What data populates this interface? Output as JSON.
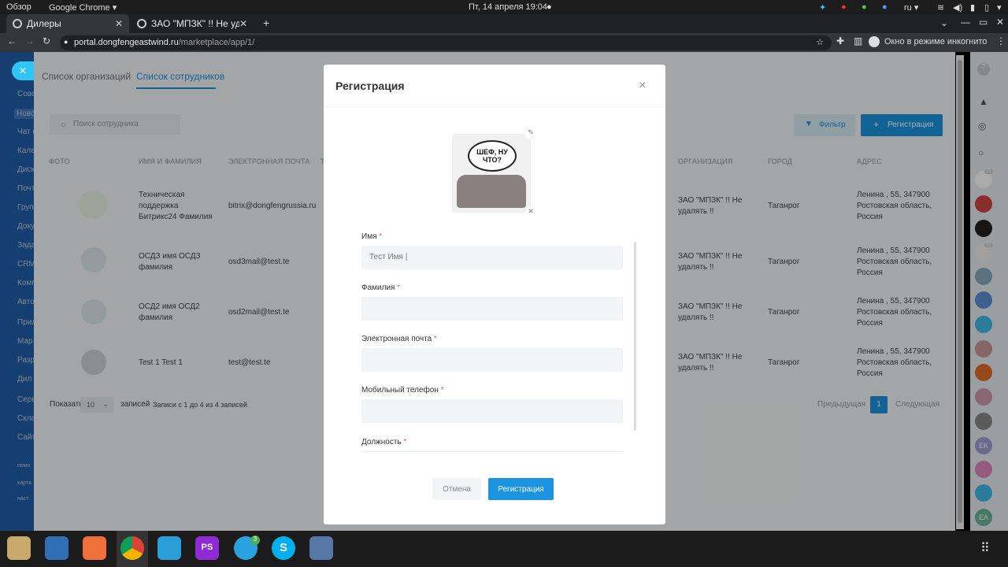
{
  "os": {
    "activities": "Обзор",
    "app_menu": "Google Chrome ▾",
    "clock": "Пт, 14 апреля  19:04",
    "lang": "ru ▾"
  },
  "browser": {
    "tabs": [
      {
        "title": "Дилеры",
        "active": true
      },
      {
        "title": "ЗАО \"МПЗК\" !! Не удалять"
      }
    ],
    "new_tab": "+",
    "url_host": "portal.dongfengeastwind.ru",
    "url_path": "/marketplace/app/1/",
    "incognito": "Окно в режиме инкогнито"
  },
  "leftnav": {
    "items": [
      "Совс",
      "Новс",
      "Чат и",
      "Кале",
      "Диск",
      "Почт",
      "Груп",
      "Доку",
      "Зада",
      "CRM",
      "Комп",
      "Авто",
      "Прил",
      "Мар",
      "Разр",
      "Дил",
      "Серв",
      "Скла",
      "Сайт",
      "помо",
      "карта",
      "наст"
    ]
  },
  "page": {
    "tabs": [
      "Список организаций",
      "Список сотрудников"
    ],
    "search_placeholder": "Поиск сотрудника",
    "filter_button": "Фильтр",
    "register_button": "Регистрация",
    "columns": [
      "ФОТО",
      "ИМЯ И ФАМИЛИЯ",
      "ЭЛЕКТРОННАЯ ПОЧТА",
      "Т",
      "ОРГАНИЗАЦИЯ",
      "ГОРОД",
      "АДРЕС"
    ],
    "rows": [
      {
        "name": "Техническая поддержка Битрикс24 Фамилия",
        "email": "bitrix@dongfengrussia.ru",
        "org": "ЗАО \"МПЗК\" !! Не удалять !!",
        "city": "Таганрог",
        "address": "Ленина , 55, 347900 Ростовская область, Россия"
      },
      {
        "name": "ОСДЗ имя ОСДЗ фамилия",
        "email": "osd3mail@test.te",
        "org": "ЗАО \"МПЗК\" !! Не удалять !!",
        "city": "Таганрог",
        "address": "Ленина , 55, 347900 Ростовская область, Россия"
      },
      {
        "name": "ОСД2 имя ОСД2 фамилия",
        "email": "osd2mail@test.te",
        "org": "ЗАО \"МПЗК\" !! Не удалять !!",
        "city": "Таганрог",
        "address": "Ленина , 55, 347900 Ростовская область, Россия"
      },
      {
        "name": "Test 1 Test 1",
        "email": "test@test.te",
        "org": "ЗАО \"МПЗК\" !! Не удалять !!",
        "city": "Таганрог",
        "address": "Ленина , 55, 347900 Ростовская область, Россия"
      }
    ],
    "show_label": "Показать",
    "page_size": "10",
    "records_label": "записей",
    "records_info": "Записи с 1 до 4 из 4 записей",
    "prev": "Предыдущая",
    "current_page": "1",
    "next": "Следующая"
  },
  "modal": {
    "title": "Регистрация",
    "close": "×",
    "avatar_text": "ШЕФ, НУ ЧТО?",
    "fields": [
      {
        "label": "Имя",
        "value": "Тест Имя |"
      },
      {
        "label": "Фамилия",
        "value": ""
      },
      {
        "label": "Электронная почта",
        "value": ""
      },
      {
        "label": "Мобильный телефон",
        "value": ""
      },
      {
        "label": "Должность",
        "value": ""
      }
    ],
    "required_mark": "*",
    "cancel": "Отмена",
    "submit": "Регистрация"
  },
  "rightbar": {
    "badges": [
      "26",
      "5",
      "60"
    ],
    "initials": [
      "EK",
      "EA"
    ]
  },
  "dock": {
    "telegram_badge": "3"
  },
  "colors": {
    "primary": "#1a94e0",
    "nav": "#1f5ea8",
    "required": "#ff5752"
  }
}
